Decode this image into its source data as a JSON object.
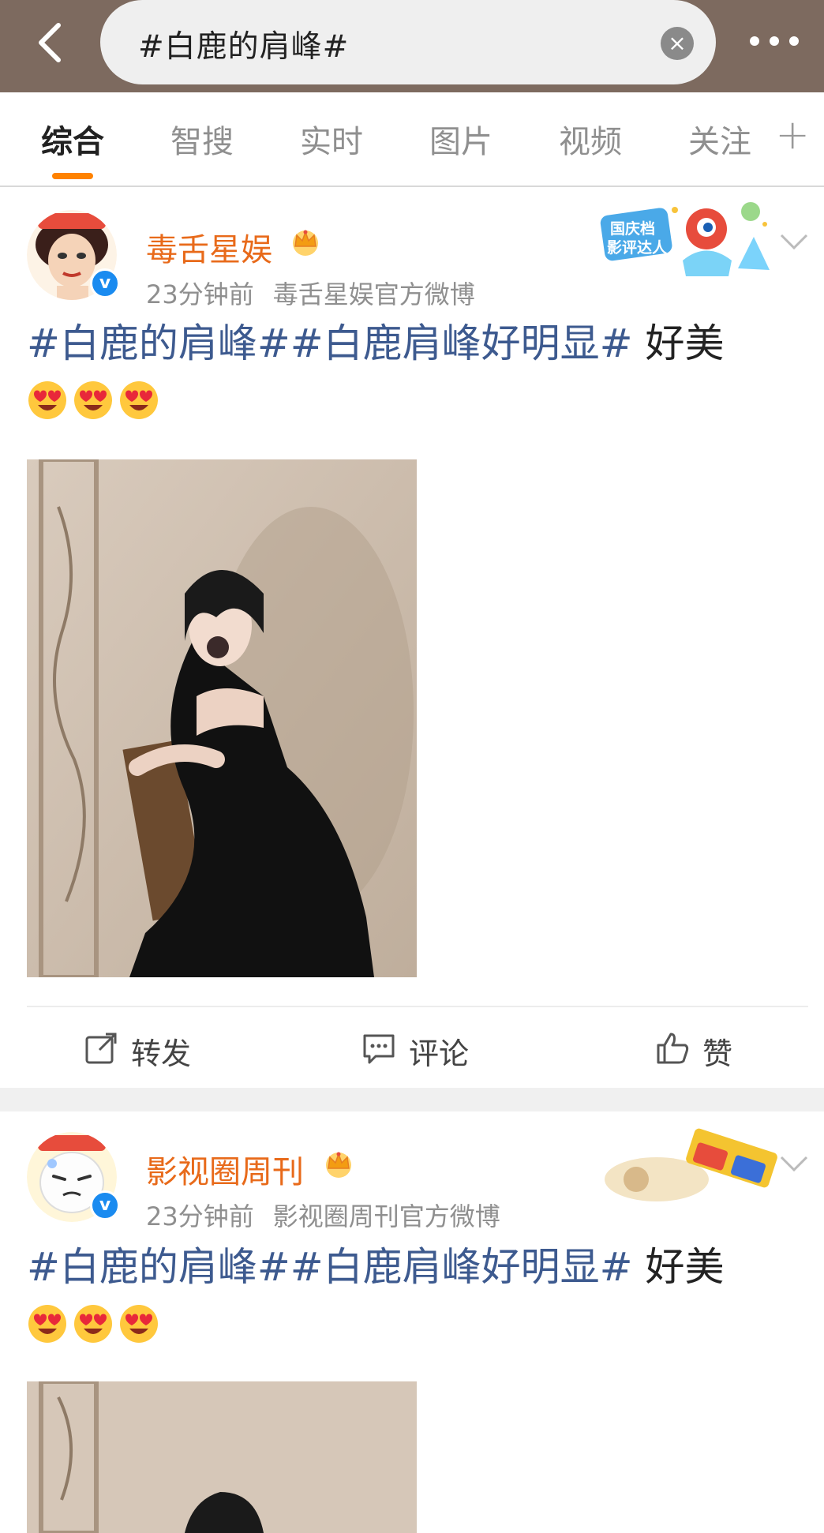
{
  "search": {
    "query": "#白鹿的肩峰#"
  },
  "tabs": [
    {
      "label": "综合"
    },
    {
      "label": "智搜"
    },
    {
      "label": "实时"
    },
    {
      "label": "图片"
    },
    {
      "label": "视频"
    },
    {
      "label": "关注"
    }
  ],
  "colors": {
    "accent": "#ff8200",
    "username": "#e86a1a",
    "hashtag": "#3d5a8f",
    "topbar": "#7d6a5f"
  },
  "posts": [
    {
      "username": "毒舌星娱",
      "time": "23分钟前",
      "source": "毒舌星娱官方微博",
      "tags": "#白鹿的肩峰##白鹿肩峰好明显#",
      "text": " 好美",
      "badge_text": "国庆档影评达人"
    },
    {
      "username": "影视圈周刊",
      "time": "23分钟前",
      "source": "影视圈周刊官方微博",
      "tags": "#白鹿的肩峰##白鹿肩峰好明显#",
      "text": " 好美"
    }
  ],
  "actions": {
    "repost": "转发",
    "comment": "评论",
    "like": "赞"
  }
}
